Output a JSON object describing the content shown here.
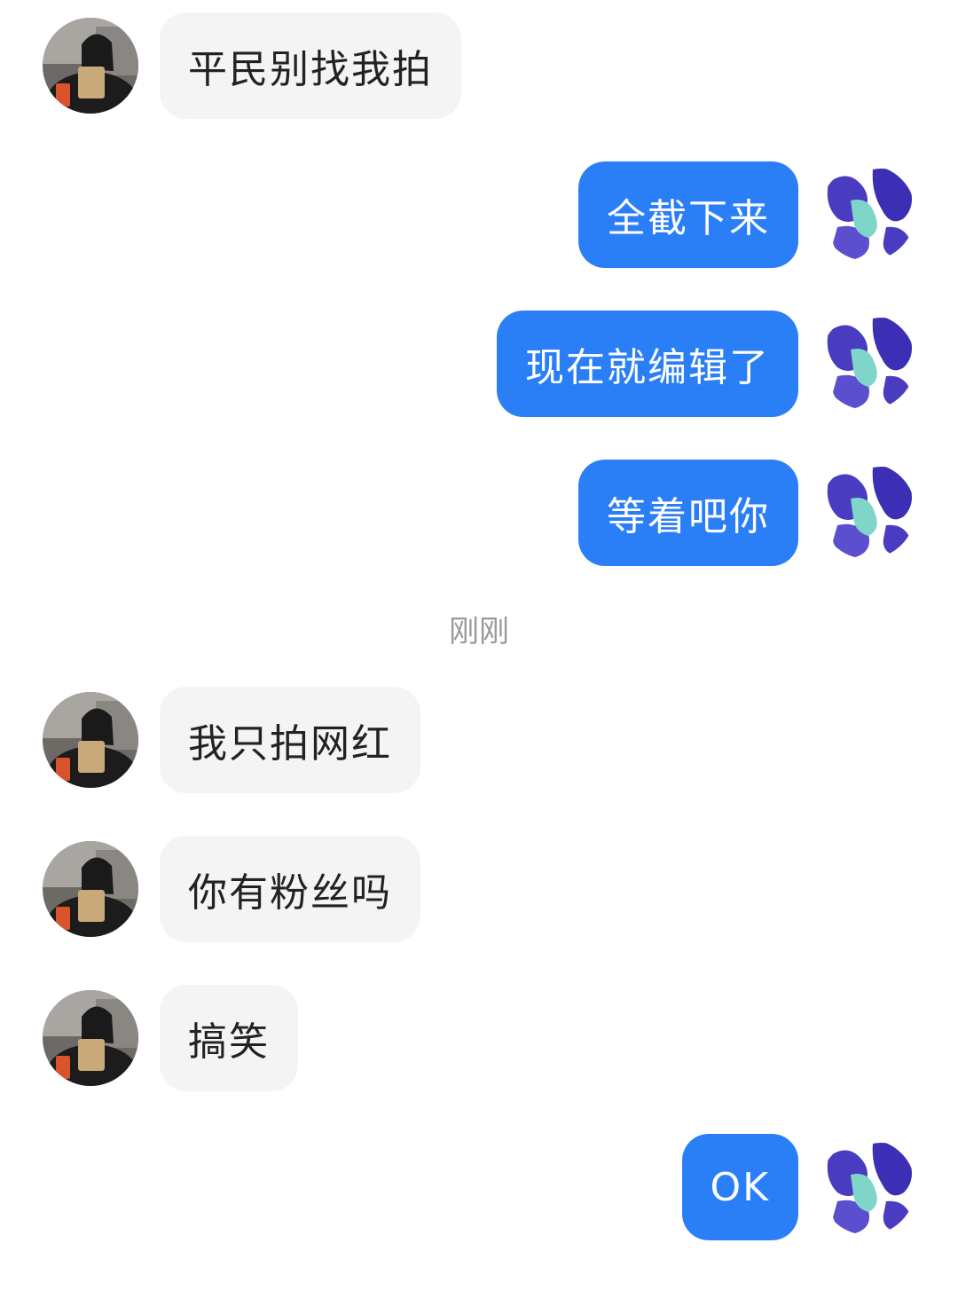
{
  "messages": [
    {
      "side": "in",
      "text": "平民别找我拍"
    },
    {
      "side": "out",
      "text": "全截下来"
    },
    {
      "side": "out",
      "text": "现在就编辑了"
    },
    {
      "side": "out",
      "text": "等着吧你"
    },
    {
      "side": "in",
      "text": "我只拍网红"
    },
    {
      "side": "in",
      "text": "你有粉丝吗"
    },
    {
      "side": "in",
      "text": "搞笑"
    },
    {
      "side": "out",
      "text": "OK"
    }
  ],
  "timestamp": "刚刚",
  "colors": {
    "outgoing_bubble": "#2b7ff6",
    "incoming_bubble": "#f4f4f4",
    "timestamp_text": "#999999"
  },
  "avatars": {
    "contact": "contact-avatar-photo",
    "self": "self-avatar-blue-pattern"
  }
}
